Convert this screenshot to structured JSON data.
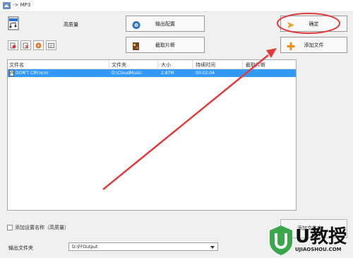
{
  "window": {
    "title": "-> MP3"
  },
  "top": {
    "quality_label": "高质量"
  },
  "buttons": {
    "output_config": "输出配置",
    "ok": "确定",
    "clip": "截取片断",
    "add_file": "添加文件",
    "add_folder": "添加文件夹"
  },
  "filelist": {
    "headers": [
      "文件名",
      "文件夹",
      "大小",
      "持续时间",
      "截取片断"
    ],
    "rows": [
      {
        "name": "DON'T CRY.ncm",
        "folder": "D:\\CloudMusic",
        "size": "2.87M",
        "duration": "00:02:04"
      }
    ]
  },
  "bottom": {
    "add_setting_label": "添加设置名称（高质量）",
    "output_folder_label": "输出文件夹",
    "output_folder_value": "D:\\FFOutput"
  },
  "watermark": {
    "text": "U教授",
    "url": "UJIAOSHOU.COM"
  },
  "colors": {
    "selection": "#3399ff",
    "annotation": "#e03b3b"
  }
}
